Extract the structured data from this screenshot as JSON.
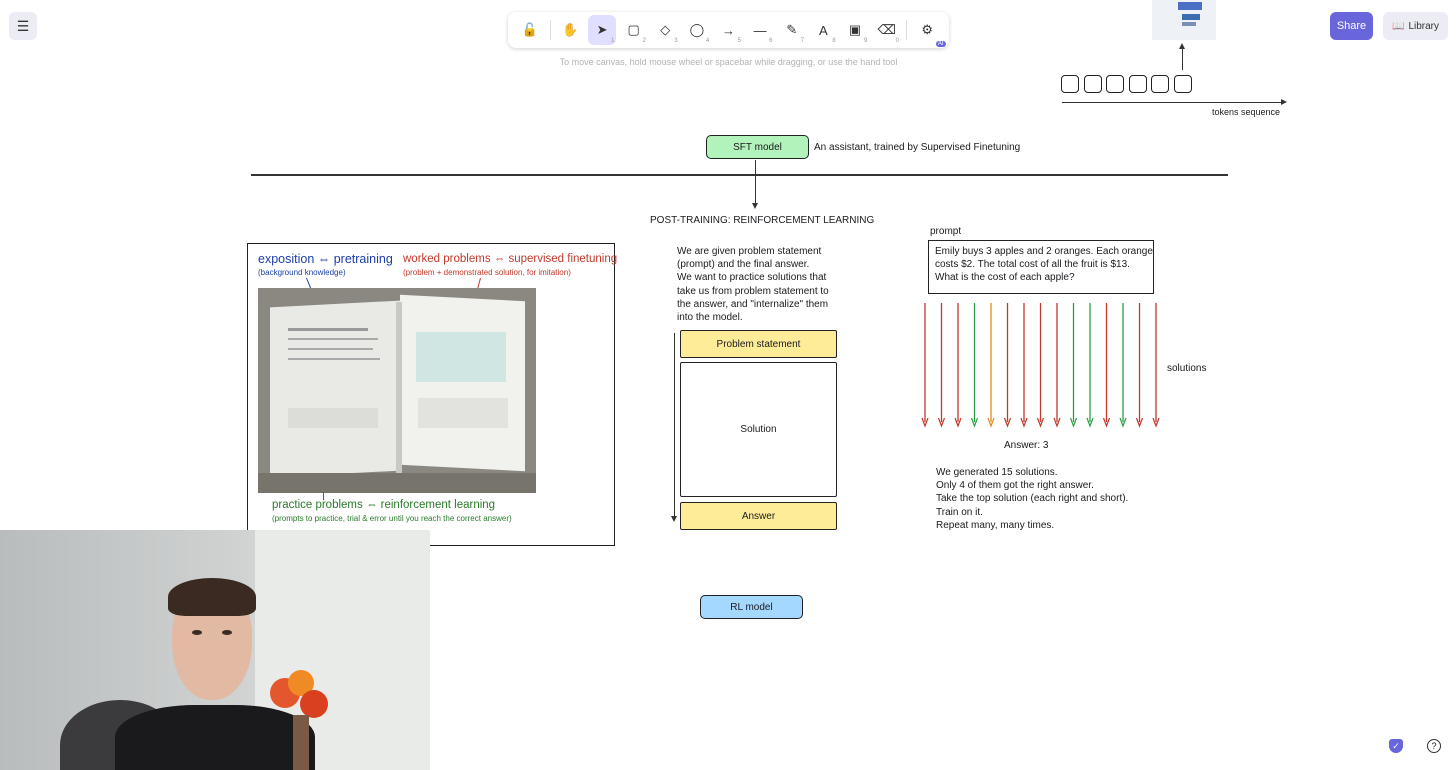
{
  "toolbar": {
    "tools": [
      {
        "name": "lock",
        "glyph": "🔓",
        "num": ""
      },
      {
        "name": "hand",
        "glyph": "✋",
        "num": ""
      },
      {
        "name": "selection",
        "glyph": "➤",
        "num": "1"
      },
      {
        "name": "rectangle",
        "glyph": "▢",
        "num": "2"
      },
      {
        "name": "diamond",
        "glyph": "◇",
        "num": "3"
      },
      {
        "name": "ellipse",
        "glyph": "◯",
        "num": "4"
      },
      {
        "name": "arrow",
        "glyph": "→",
        "num": "5"
      },
      {
        "name": "line",
        "glyph": "—",
        "num": "6"
      },
      {
        "name": "draw",
        "glyph": "✎",
        "num": "7"
      },
      {
        "name": "text",
        "glyph": "A",
        "num": "8"
      },
      {
        "name": "image",
        "glyph": "▣",
        "num": "9"
      },
      {
        "name": "eraser",
        "glyph": "⌫",
        "num": "0"
      },
      {
        "name": "more-tools",
        "glyph": "⚙",
        "num": ""
      }
    ],
    "ai_badge": "AI",
    "hint": "To move canvas, hold mouse wheel or spacebar while dragging, or use the hand tool"
  },
  "header": {
    "share_label": "Share",
    "library_label": "Library"
  },
  "canvas": {
    "tokens_label": "tokens sequence",
    "sft_model_label": "SFT model",
    "sft_desc": "An assistant, trained by Supervised Finetuning",
    "section_title": "POST-TRAINING: REINFORCEMENT LEARNING",
    "book": {
      "exposition": "exposition ⇔ pretraining",
      "exposition_sub": "(background knowledge)",
      "worked": "worked problems ⇔ supervised finetuning",
      "worked_sub": "(problem + demonstrated solution, for imitation)",
      "practice": "practice problems ⇔ reinforcement learning",
      "practice_sub": "(prompts to practice, trial & error until you reach the correct answer)"
    },
    "explain_lines": [
      "We are given problem statement",
      "(prompt) and the final answer.",
      "We want to practice solutions that",
      "take us from problem statement to",
      "the answer, and \"internalize\" them",
      "into the model."
    ],
    "problem_statement_label": "Problem statement",
    "solution_label": "Solution",
    "answer_label": "Answer",
    "prompt_label": "prompt",
    "prompt_lines": [
      "Emily buys 3 apples and 2 oranges. Each orange",
      "costs $2. The total cost of all the fruit is $13.",
      "What is the cost of each apple?"
    ],
    "solutions_label": "solutions",
    "solution_arrow_colors": [
      "#c0392b",
      "#c0392b",
      "#c0392b",
      "#2e9e44",
      "#e08a1e",
      "#c0392b",
      "#c0392b",
      "#c0392b",
      "#c0392b",
      "#2e9e44",
      "#2e9e44",
      "#c0392b",
      "#2e9e44",
      "#c0392b",
      "#c0392b"
    ],
    "answer_result": "Answer: 3",
    "summary_lines": [
      "We generated 15 solutions.",
      "Only 4 of them got the right answer.",
      "Take the top solution (each right and short).",
      "Train on it.",
      "Repeat many, many times."
    ],
    "rl_model_label": "RL model"
  },
  "colors": {
    "accent": "#6965db",
    "sft_fill": "#b2f2bb",
    "rl_fill": "#a5d8ff",
    "yellow_fill": "#ffec99",
    "blue_text": "#1c3fa8",
    "red_text": "#c0392b",
    "green_text": "#2b7a2b"
  }
}
